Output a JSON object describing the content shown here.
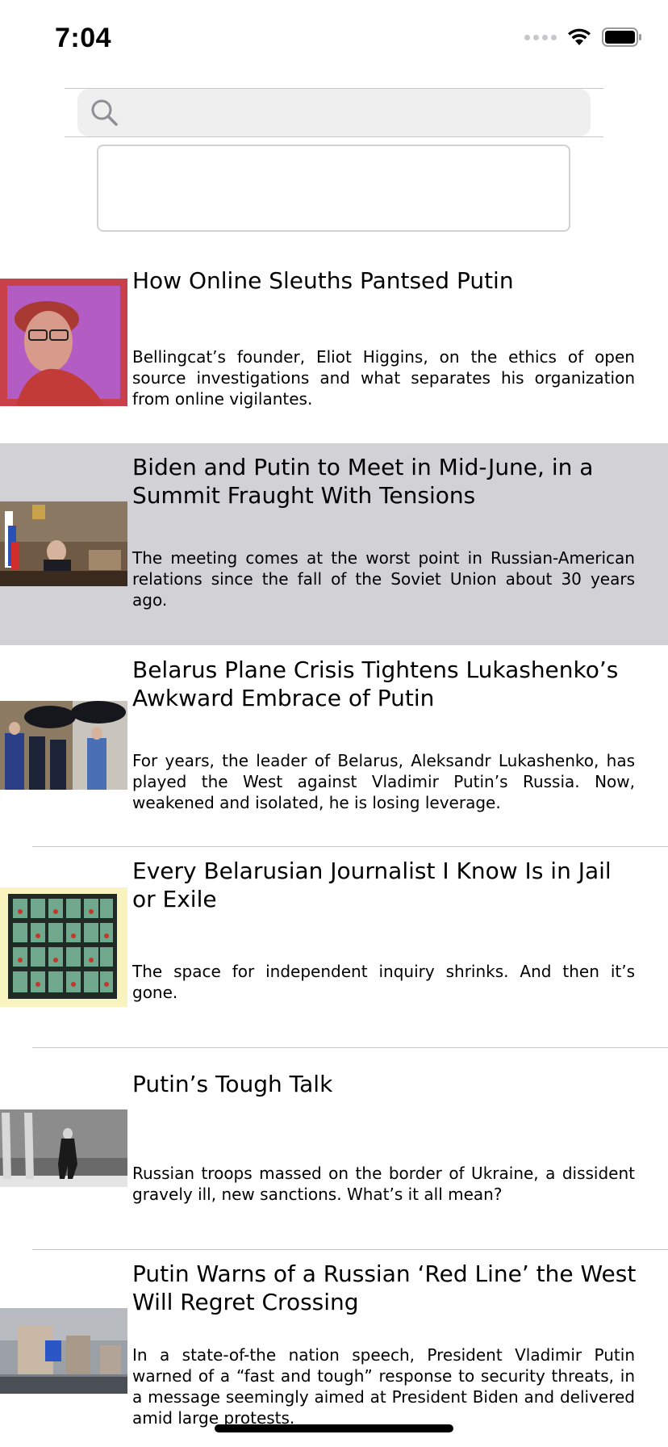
{
  "status_bar": {
    "time": "7:04",
    "icons": [
      "cellular-signal-icon",
      "wifi-icon",
      "battery-icon"
    ]
  },
  "search": {
    "value": "",
    "placeholder": "",
    "icon": "search-icon"
  },
  "text_box": {
    "value": ""
  },
  "articles": [
    {
      "title": "How Online Sleuths Pantsed Putin",
      "summary": "Bellingcat’s founder, Eliot Higgins, on the ethics of open source investigations and what separates his organization from online vigilantes.",
      "selected": false
    },
    {
      "title": "Biden and Putin to Meet in Mid-June, in a Summit Fraught With Tensions",
      "summary": "The meeting comes at the worst point in Russian-American relations since the fall of the Soviet Union about 30 years ago.",
      "selected": true
    },
    {
      "title": "Belarus Plane Crisis Tightens Lukashenko’s Awkward Embrace of Putin",
      "summary": "For years, the leader of Belarus, Aleksandr Lukashenko, has played the West against Vladimir Putin’s Russia. Now, weakened and isolated, he is losing leverage.",
      "selected": false
    },
    {
      "title": "Every Belarusian Journalist I Know Is in Jail or Exile",
      "summary": "The space for independent inquiry shrinks. And then it’s gone.",
      "selected": false
    },
    {
      "title": "Putin’s Tough Talk",
      "summary": "Russian troops massed on the border of Ukraine, a dissident gravely ill, new sanctions. What’s it all mean?",
      "selected": false
    },
    {
      "title": "Putin Warns of a Russian ‘Red Line’ the West Will Regret Crossing",
      "summary": "In a state-of-the nation speech, President Vladimir Putin warned of a “fast and tough” response to security threats, in a message seemingly aimed at President Biden and delivered amid large protests.",
      "selected": false
    }
  ],
  "colors": {
    "selected_row": "#d1d1d6",
    "separator": "#c6c6c8",
    "search_bg": "#efefef"
  }
}
